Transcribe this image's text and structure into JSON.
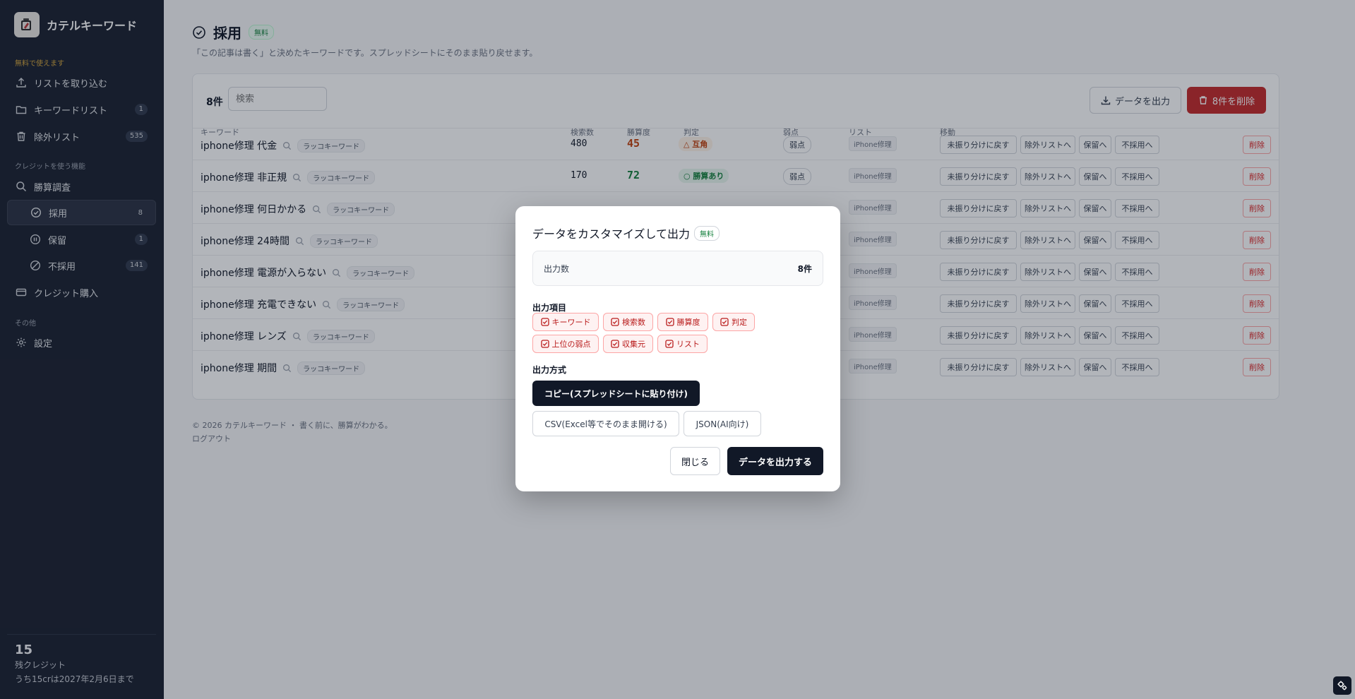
{
  "app": {
    "title": "カテルキーワード"
  },
  "sidebar": {
    "section_free": "無料で使えます",
    "section_credit": "クレジットを使う機能",
    "section_other": "その他",
    "items": [
      {
        "label": "リストを取り込む",
        "icon": "upload-icon"
      },
      {
        "label": "キーワードリスト",
        "count": "1",
        "icon": "folder-icon"
      },
      {
        "label": "除外リスト",
        "count": "535",
        "icon": "trash-icon"
      },
      {
        "label": "勝算調査",
        "icon": "search-icon"
      },
      {
        "label": "採用",
        "count": "8",
        "icon": "check-circle-icon",
        "active": true
      },
      {
        "label": "保留",
        "count": "1",
        "icon": "pause-circle-icon"
      },
      {
        "label": "不採用",
        "count": "141",
        "icon": "ban-icon"
      },
      {
        "label": "クレジット購入",
        "icon": "credit-card-icon"
      },
      {
        "label": "設定",
        "icon": "gear-icon"
      }
    ],
    "credits": {
      "value": "15",
      "label": "残クレジット",
      "note": "うち15crは2027年2月6日まで"
    }
  },
  "page": {
    "title": "採用",
    "badge": "無料",
    "description": "「この記事は書く」と決めたキーワードです。スプレッドシートにそのまま貼り戻せます。"
  },
  "toolbar": {
    "count": "8件",
    "search_placeholder": "検索",
    "export_label": "データを出力",
    "delete_all_label": "8件を削除"
  },
  "table": {
    "headers": {
      "keyword": "キーワード",
      "volume": "検索数",
      "score": "勝算度",
      "judge": "判定",
      "weak": "弱点",
      "list": "リスト",
      "move": "移動"
    },
    "rows": [
      {
        "keyword": "iphone修理 代金",
        "tag": "ラッコキーワード",
        "volume": "480",
        "score": "45",
        "judge": "△ 互角",
        "weak": "弱点",
        "list": "iPhone修理"
      },
      {
        "keyword": "iphone修理 非正規",
        "tag": "ラッコキーワード",
        "volume": "170",
        "score": "72",
        "judge": "○ 勝算あり",
        "weak": "弱点",
        "list": "iPhone修理"
      },
      {
        "keyword": "iphone修理 何日かかる",
        "tag": "ラッコキーワード",
        "list": "iPhone修理"
      },
      {
        "keyword": "iphone修理 24時間",
        "tag": "ラッコキーワード",
        "list": "iPhone修理"
      },
      {
        "keyword": "iphone修理 電源が入らない",
        "tag": "ラッコキーワード",
        "list": "iPhone修理"
      },
      {
        "keyword": "iphone修理 充電できない",
        "tag": "ラッコキーワード",
        "list": "iPhone修理"
      },
      {
        "keyword": "iphone修理 レンズ",
        "tag": "ラッコキーワード",
        "list": "iPhone修理"
      },
      {
        "keyword": "iphone修理 期間",
        "tag": "ラッコキーワード",
        "list": "iPhone修理"
      }
    ],
    "actions": {
      "unsorted": "未振り分けに戻す",
      "exclude": "除外リストへ",
      "hold": "保留へ",
      "reject": "不採用へ",
      "delete": "削除"
    }
  },
  "footer": {
    "copyright": "© 2026 カテルキーワード ・ 書く前に、勝算がわかる。",
    "logout": "ログアウト"
  },
  "modal": {
    "title": "データをカスタマイズして出力",
    "badge": "無料",
    "count_label": "出力数",
    "count_value": "8件",
    "fields_label": "出力項目",
    "fields": [
      "キーワード",
      "検索数",
      "勝算度",
      "判定",
      "上位の弱点",
      "収集元",
      "リスト"
    ],
    "format_label": "出力方式",
    "formats": [
      "コピー(スプレッドシートに貼り付け)",
      "CSV(Excel等でそのまま開ける)",
      "JSON(AI向け)"
    ],
    "selected_format": "コピー(スプレッドシートに貼り付け)",
    "close": "閉じる",
    "submit": "データを出力する"
  },
  "colors": {
    "sidebar_bg": "#1b2130",
    "accent_red": "#c52a2a",
    "orange": "#c2410c",
    "green": "#15803d",
    "gold": "#d4a53c"
  }
}
